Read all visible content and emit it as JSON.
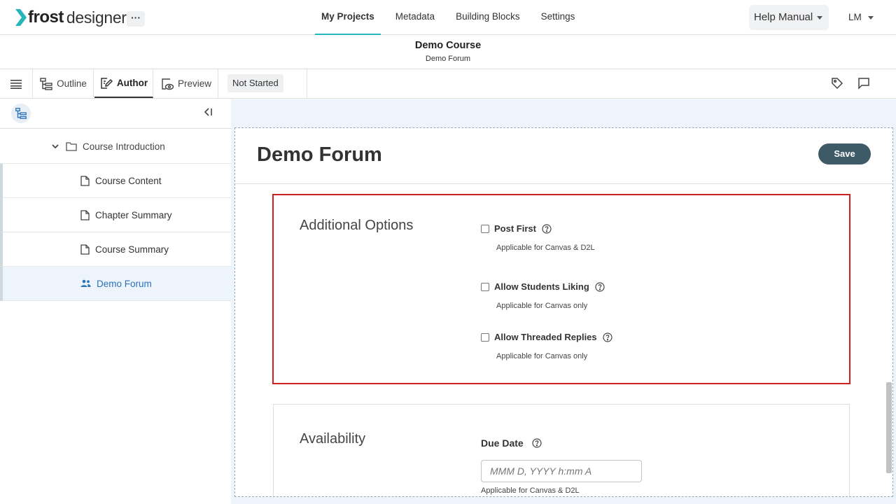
{
  "app": {
    "logo_word1": "frost",
    "logo_word2": "designer",
    "more_label": "···",
    "accent": "#26b5b8"
  },
  "nav": {
    "tabs": [
      {
        "label": "My Projects",
        "active": true
      },
      {
        "label": "Metadata"
      },
      {
        "label": "Building Blocks"
      },
      {
        "label": "Settings"
      }
    ],
    "help_label": "Help Manual",
    "user_label": "LM"
  },
  "course": {
    "title": "Demo Course",
    "subtitle": "Demo Forum"
  },
  "toolbar": {
    "outline_label": "Outline",
    "author_label": "Author",
    "preview_label": "Preview",
    "status_label": "Not Started"
  },
  "sidebar": {
    "collapse_label": "<I",
    "folder": {
      "label": "Course Introduction"
    },
    "items": [
      {
        "label": "Course Content",
        "icon": "document-icon"
      },
      {
        "label": "Chapter Summary",
        "icon": "document-icon"
      },
      {
        "label": "Course Summary",
        "icon": "document-icon"
      },
      {
        "label": "Demo Forum",
        "icon": "forum-people-icon",
        "selected": true
      }
    ]
  },
  "editor": {
    "title": "Demo Forum",
    "save_label": "Save",
    "additional_options": {
      "title": "Additional Options",
      "options": [
        {
          "label": "Post First",
          "note": "Applicable for Canvas & D2L",
          "checked": false
        },
        {
          "label": "Allow Students Liking",
          "note": "Applicable for Canvas only",
          "checked": false
        },
        {
          "label": "Allow Threaded Replies",
          "note": "Applicable for Canvas only",
          "checked": false
        }
      ]
    },
    "availability": {
      "title": "Availability",
      "due_date_label": "Due Date",
      "due_date_placeholder": "MMM D, YYYY h:mm A",
      "due_date_value": "",
      "due_date_note": "Applicable for Canvas & D2L"
    }
  },
  "colors": {
    "highlight_border": "#d0201f",
    "save_button": "#3d5a66",
    "main_bg": "#eef4fb",
    "selected_text": "#2a72b8"
  }
}
